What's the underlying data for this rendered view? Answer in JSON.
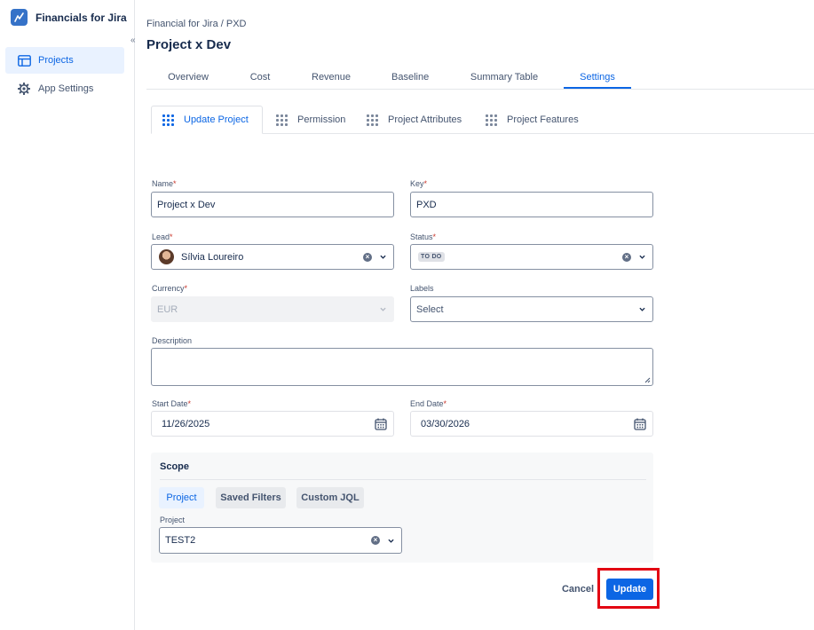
{
  "app": {
    "name": "Financials for Jira",
    "collapse_glyph": "«"
  },
  "sidebar": {
    "items": [
      {
        "label": "Projects",
        "icon": "board-icon",
        "active": true
      },
      {
        "label": "App Settings",
        "icon": "gear-icon",
        "active": false
      }
    ]
  },
  "header": {
    "breadcrumb": "Financial for Jira  / PXD",
    "title": "Project x Dev"
  },
  "tabs": [
    {
      "label": "Overview"
    },
    {
      "label": "Cost"
    },
    {
      "label": "Revenue"
    },
    {
      "label": "Baseline"
    },
    {
      "label": "Summary Table"
    },
    {
      "label": "Settings",
      "active": true
    }
  ],
  "subtabs": [
    {
      "label": "Update Project",
      "active": true
    },
    {
      "label": "Permission"
    },
    {
      "label": "Project Attributes"
    },
    {
      "label": "Project Features"
    }
  ],
  "form": {
    "name": {
      "label": "Name",
      "required": "*",
      "value": "Project x Dev"
    },
    "key": {
      "label": "Key",
      "required": "*",
      "value": "PXD"
    },
    "lead": {
      "label": "Lead",
      "required": "*",
      "value": "Sílvia Loureiro"
    },
    "status": {
      "label": "Status",
      "required": "*",
      "value": "TO DO"
    },
    "currency": {
      "label": "Currency",
      "required": "*",
      "value": "EUR"
    },
    "labels": {
      "label": "Labels",
      "placeholder": "Select"
    },
    "description": {
      "label": "Description",
      "value": ""
    },
    "start_date": {
      "label": "Start Date",
      "required": "*",
      "value": "11/26/2025"
    },
    "end_date": {
      "label": "End Date",
      "required": "*",
      "value": "03/30/2026"
    }
  },
  "scope": {
    "title": "Scope",
    "options": [
      {
        "label": "Project",
        "active": true
      },
      {
        "label": "Saved Filters"
      },
      {
        "label": "Custom JQL"
      }
    ],
    "project_label": "Project",
    "project_value": "TEST2"
  },
  "actions": {
    "cancel": "Cancel",
    "update": "Update"
  },
  "colors": {
    "accent": "#0c66e4",
    "highlight": "#e30613",
    "required": "#c9372c"
  }
}
